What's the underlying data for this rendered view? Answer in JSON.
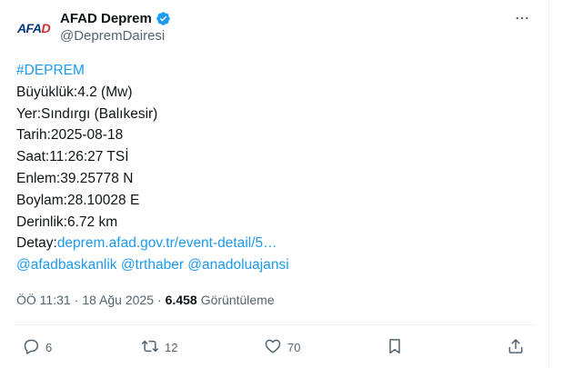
{
  "account": {
    "avatar_text_main": "AFA",
    "avatar_text_accent": "D",
    "display_name": "AFAD Deprem",
    "handle": "@DepremDairesi"
  },
  "tweet": {
    "hashtag": "#DEPREM",
    "lines": [
      "Büyüklük:4.2 (Mw)",
      "Yer:Sındırgı (Balıkesir)",
      "Tarih:2025-08-18",
      "Saat:11:26:27 TSİ",
      "Enlem:39.25778 N",
      "Boylam:28.10028 E",
      "Derinlik:6.72 km"
    ],
    "detail_label": "Detay:",
    "detail_link": "deprem.afad.gov.tr/event-detail/5…",
    "mentions": "@afadbaskanlik @trthaber @anadoluajansi"
  },
  "meta": {
    "time": "ÖÖ 11:31",
    "dot": "·",
    "date": "18 Ağu 2025",
    "views_count": "6.458",
    "views_label": "Görüntüleme"
  },
  "actions": {
    "replies": "6",
    "retweets": "12",
    "likes": "70"
  },
  "colors": {
    "link": "#1d9bf0",
    "text": "#0f1419",
    "secondary": "#536471"
  }
}
